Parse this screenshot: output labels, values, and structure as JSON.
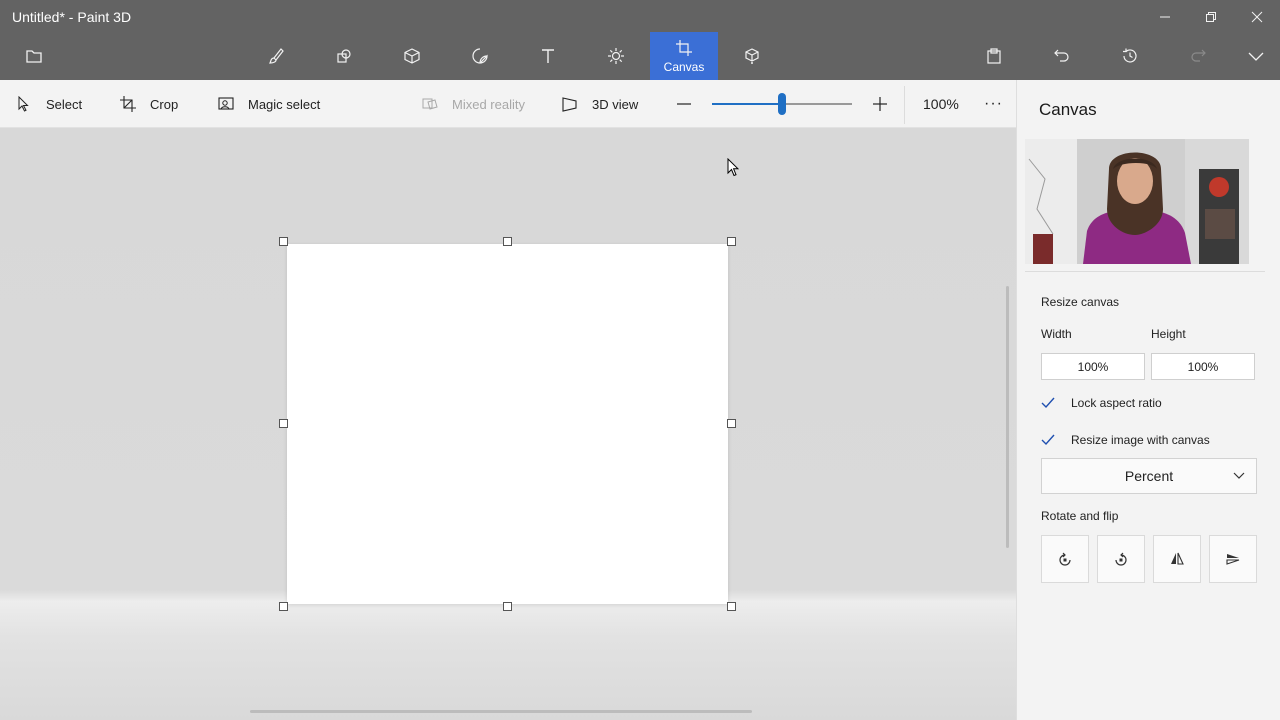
{
  "window": {
    "title": "Untitled* - Paint 3D",
    "controls": [
      "minimize-icon",
      "restore-icon",
      "close-icon"
    ]
  },
  "toolbar": {
    "tools": [
      {
        "name": "brushes",
        "icon": "brush-icon"
      },
      {
        "name": "2d-shapes",
        "icon": "shapes-2d-icon"
      },
      {
        "name": "3d-shapes",
        "icon": "cube-icon"
      },
      {
        "name": "stickers",
        "icon": "sticker-icon"
      },
      {
        "name": "text",
        "icon": "text-icon"
      },
      {
        "name": "effects",
        "icon": "effects-sun-icon"
      },
      {
        "name": "canvas",
        "icon": "canvas-crop-icon",
        "label": "Canvas",
        "active": true
      },
      {
        "name": "3d-library",
        "icon": "library-3d-icon"
      }
    ],
    "right_icons": [
      "paste-icon",
      "undo-icon",
      "history-icon",
      "redo-icon",
      "expand-chevron-icon"
    ],
    "active_color": "#3b6fd6"
  },
  "subbar": {
    "select_label": "Select",
    "crop_label": "Crop",
    "magic_select_label": "Magic select",
    "mixed_reality_label": "Mixed reality",
    "view3d_label": "3D view",
    "zoom_value": "100%",
    "zoom_level": 0.5,
    "more_label": "···"
  },
  "panel": {
    "title": "Canvas",
    "resize_heading": "Resize canvas",
    "width_label": "Width",
    "height_label": "Height",
    "width_value": "100%",
    "height_value": "100%",
    "lock_aspect_label": "Lock aspect ratio",
    "lock_aspect_checked": true,
    "resize_image_label": "Resize image with canvas",
    "resize_image_checked": true,
    "unit_selected": "Percent",
    "rotate_heading": "Rotate and flip",
    "rotate_buttons": [
      "rotate-left-icon",
      "rotate-right-icon",
      "flip-vertical-icon",
      "flip-horizontal-icon"
    ]
  },
  "colors": {
    "topbar": "#636363",
    "accent": "#3b6fd6",
    "slider": "#1f6fc4",
    "panel_bg": "#f3f3f3",
    "workspace_bg": "#d8d8d8"
  }
}
